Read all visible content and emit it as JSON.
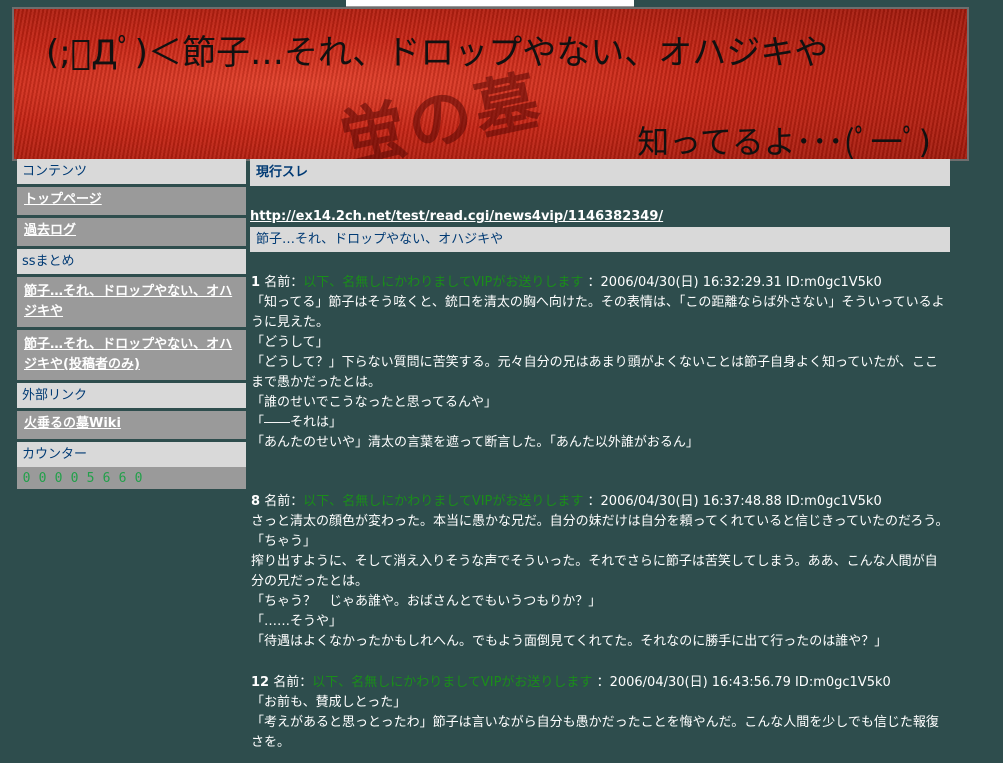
{
  "header": {
    "title": "(;ﾟДﾟ)＜節子…それ、ドロップやない、オハジキや",
    "subtitle": "知ってるよ･･･(ﾟ一ﾟ)",
    "watermark": "蛍の墓"
  },
  "sidebar": {
    "contents_heading": "コンテンツ",
    "items": [
      {
        "label": "トップページ"
      },
      {
        "label": "過去ログ"
      }
    ],
    "ss_heading": "ssまとめ",
    "ss_items": [
      {
        "label": "節子…それ、ドロップやない、オハジキや"
      },
      {
        "label": "節子…それ、ドロップやない、オハジキや(投稿者のみ)"
      }
    ],
    "links_heading": "外部リンク",
    "link_items": [
      {
        "label": "火垂るの墓Wiki"
      }
    ],
    "counter_heading": "カウンター",
    "counter_value": "00005660"
  },
  "main": {
    "section_heading": "現行スレ",
    "thread_url": "http://ex14.2ch.net/test/read.cgi/news4vip/1146382349/",
    "thread_title": "節子…それ、ドロップやない、オハジキや",
    "name_label": "名前：",
    "poster_name": "以下、名無しにかわりましてVIPがお送りします",
    "posts": [
      {
        "num": "1",
        "meta": "：2006/04/30(日) 16:32:29.31 ID:m0gc1V5k0",
        "lines": [
          "「知ってる」節子はそう呟くと、銃口を清太の胸へ向けた。その表情は、「この距離ならば外さない」そういっているように見えた。",
          "「どうして」",
          "「どうして？」下らない質問に苦笑する。元々自分の兄はあまり頭がよくないことは節子自身よく知っていたが、ここまで愚かだったとは。",
          "「誰のせいでこうなったと思ってるんや」",
          "「――それは」",
          "「あんたのせいや」清太の言葉を遮って断言した。「あんた以外誰がおるん」"
        ]
      },
      {
        "num": "8",
        "meta": "：2006/04/30(日) 16:37:48.88 ID:m0gc1V5k0",
        "lines": [
          "さっと清太の顔色が変わった。本当に愚かな兄だ。自分の妹だけは自分を頼ってくれていると信じきっていたのだろう。",
          "「ちゃう」",
          "搾り出すように、そして消え入りそうな声でそういった。それでさらに節子は苦笑してしまう。ああ、こんな人間が自分の兄だったとは。",
          "「ちゃう？　じゃあ誰や。おばさんとでもいうつもりか？」",
          "「……そうや」",
          "「待遇はよくなかったかもしれへん。でもよう面倒見てくれてた。それなのに勝手に出て行ったのは誰や？」"
        ]
      },
      {
        "num": "12",
        "meta": "：2006/04/30(日) 16:43:56.79 ID:m0gc1V5k0",
        "lines": [
          "「お前も、賛成しとった」",
          "「考えがあると思っとったわ」節子は言いながら自分も愚かだったことを悔やんだ。こんな人間を少しでも信じた報復さを。"
        ]
      }
    ]
  }
}
